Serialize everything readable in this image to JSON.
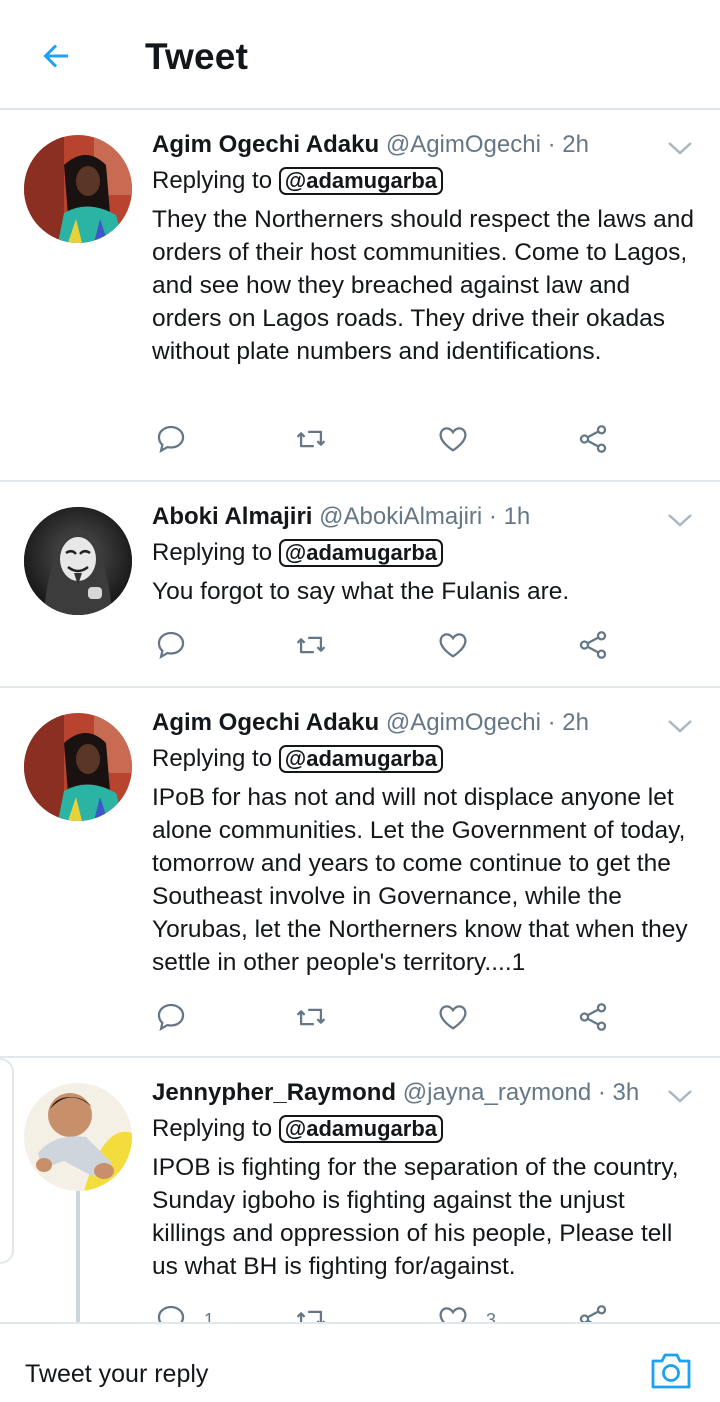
{
  "header": {
    "title": "Tweet",
    "back_icon": "arrow-left-icon",
    "accent": "#1da1f2"
  },
  "tweets": [
    {
      "name": "Agim Ogechi Adaku",
      "handle": "@AgimOgechi",
      "time": "· 2h",
      "replying_label": "Replying to",
      "replying_to": "@adamugarba",
      "text": "They the Northerners should respect the laws and orders of their host communities. Come to Lagos, and see how they breached against law and orders on Lagos roads. They drive their okadas without plate numbers and identifications.",
      "reply_count": "",
      "retweet_count": "",
      "like_count": ""
    },
    {
      "name": "Aboki Almajiri",
      "handle": "@AbokiAlmajiri",
      "time": "· 1h",
      "replying_label": "Replying to",
      "replying_to": "@adamugarba",
      "text": "You forgot to say what the Fulanis are.",
      "reply_count": "",
      "retweet_count": "",
      "like_count": ""
    },
    {
      "name": "Agim Ogechi Adaku",
      "handle": "@AgimOgechi",
      "time": "· 2h",
      "replying_label": "Replying to",
      "replying_to": "@adamugarba",
      "text": "IPoB for has not and will not displace anyone let alone communities. Let the Government of today, tomorrow and years to come continue to get the Southeast involve in Governance, while the Yorubas, let the Northerners know that when they settle in other people's territory....1",
      "reply_count": "",
      "retweet_count": "",
      "like_count": ""
    },
    {
      "name": "Jennypher_Raymond",
      "handle": "@jayna_raymond",
      "time": "· 3h",
      "replying_label": "Replying to",
      "replying_to": "@adamugarba",
      "text": "IPOB is fighting for the separation of the country, Sunday igboho is fighting against the unjust killings and oppression of his people, Please tell us what BH is fighting for/against.",
      "reply_count": "1",
      "retweet_count": "",
      "like_count": "3"
    }
  ],
  "reply_bar": {
    "placeholder": "Tweet your reply",
    "camera_icon": "camera-icon"
  }
}
